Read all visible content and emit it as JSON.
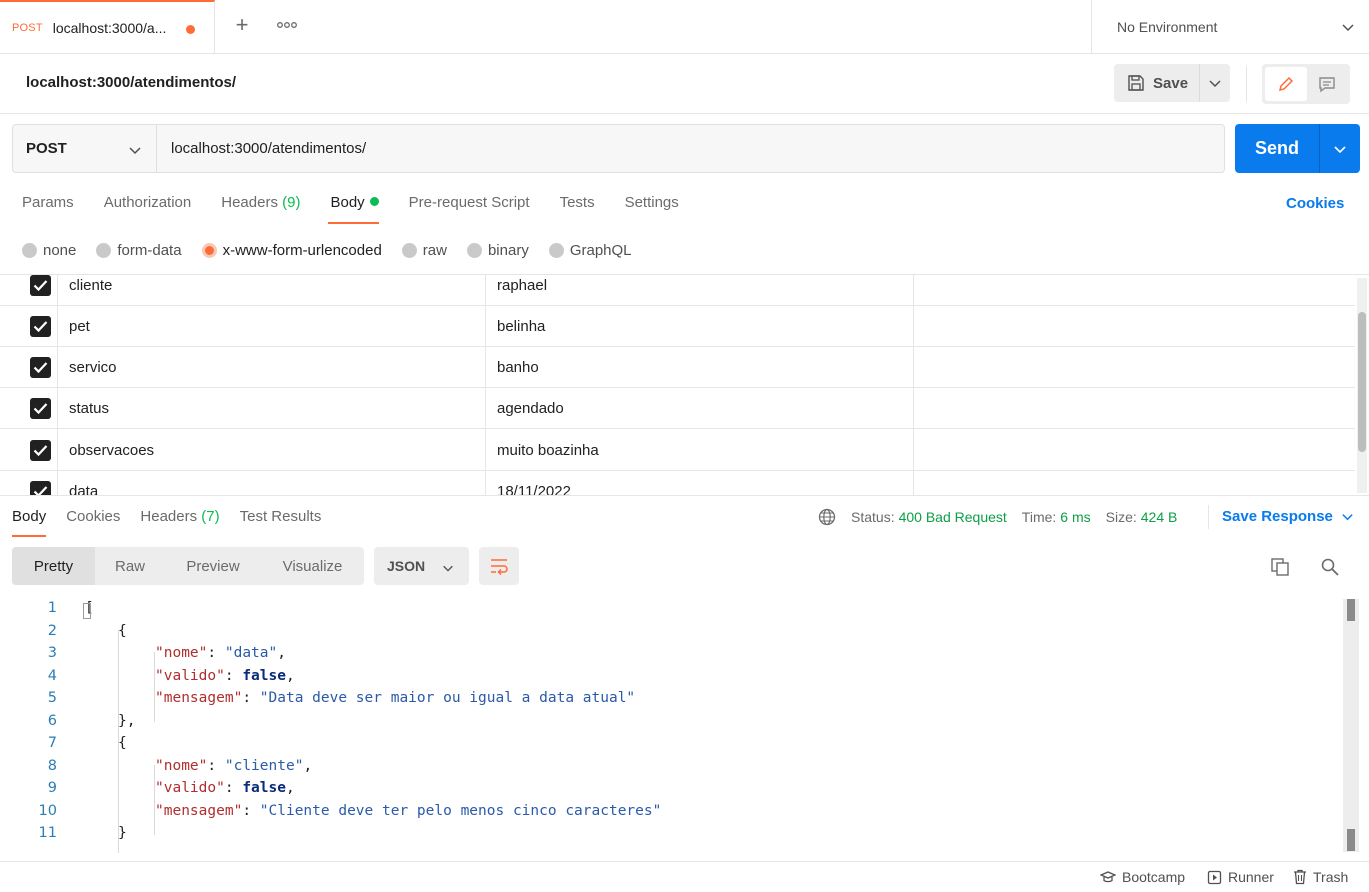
{
  "tab": {
    "method": "POST",
    "title": "localhost:3000/a..."
  },
  "environment": {
    "label": "No Environment"
  },
  "request": {
    "name": "localhost:3000/atendimentos/",
    "save_label": "Save",
    "method": "POST",
    "url": "localhost:3000/atendimentos/",
    "send_label": "Send"
  },
  "req_tabs": {
    "params": "Params",
    "authorization": "Authorization",
    "headers": "Headers",
    "headers_count": "(9)",
    "body": "Body",
    "prerequest": "Pre-request Script",
    "tests": "Tests",
    "settings": "Settings",
    "cookies": "Cookies"
  },
  "body_types": [
    "none",
    "form-data",
    "x-www-form-urlencoded",
    "raw",
    "binary",
    "GraphQL"
  ],
  "params": [
    {
      "key": "cliente",
      "value": "raphael"
    },
    {
      "key": "pet",
      "value": "belinha"
    },
    {
      "key": "servico",
      "value": "banho"
    },
    {
      "key": "status",
      "value": "agendado"
    },
    {
      "key": "observacoes",
      "value": "muito boazinha"
    },
    {
      "key": "data",
      "value": "18/11/2022"
    }
  ],
  "response": {
    "tabs": {
      "body": "Body",
      "cookies": "Cookies",
      "headers": "Headers",
      "headers_count": "(7)",
      "tests": "Test Results"
    },
    "status_label": "Status:",
    "status_value": "400 Bad Request",
    "time_label": "Time:",
    "time_value": "6 ms",
    "size_label": "Size:",
    "size_value": "424 B",
    "save_response": "Save Response"
  },
  "viewer": {
    "modes": [
      "Pretty",
      "Raw",
      "Preview",
      "Visualize"
    ],
    "language": "JSON"
  },
  "code_lines": [
    "1",
    "2",
    "3",
    "4",
    "5",
    "6",
    "7",
    "8",
    "9",
    "10",
    "11"
  ],
  "code": {
    "open_bracket": "[",
    "open_brace": "{",
    "close_brace_comma": "},",
    "close_brace": "}",
    "k_nome": "\"nome\"",
    "k_valido": "\"valido\"",
    "k_mensagem": "\"mensagem\"",
    "v_data": "\"data\"",
    "v_false": "false",
    "v_msg1": "\"Data deve ser maior ou igual a data atual\"",
    "v_cliente": "\"cliente\"",
    "v_msg2": "\"Cliente deve ter pelo menos cinco caracteres\""
  },
  "statusbar": {
    "bootcamp": "Bootcamp",
    "runner": "Runner",
    "trash": "Trash"
  },
  "colors": {
    "accent": "#ff6c37",
    "primary": "#097bed",
    "success": "#0cbb52"
  }
}
